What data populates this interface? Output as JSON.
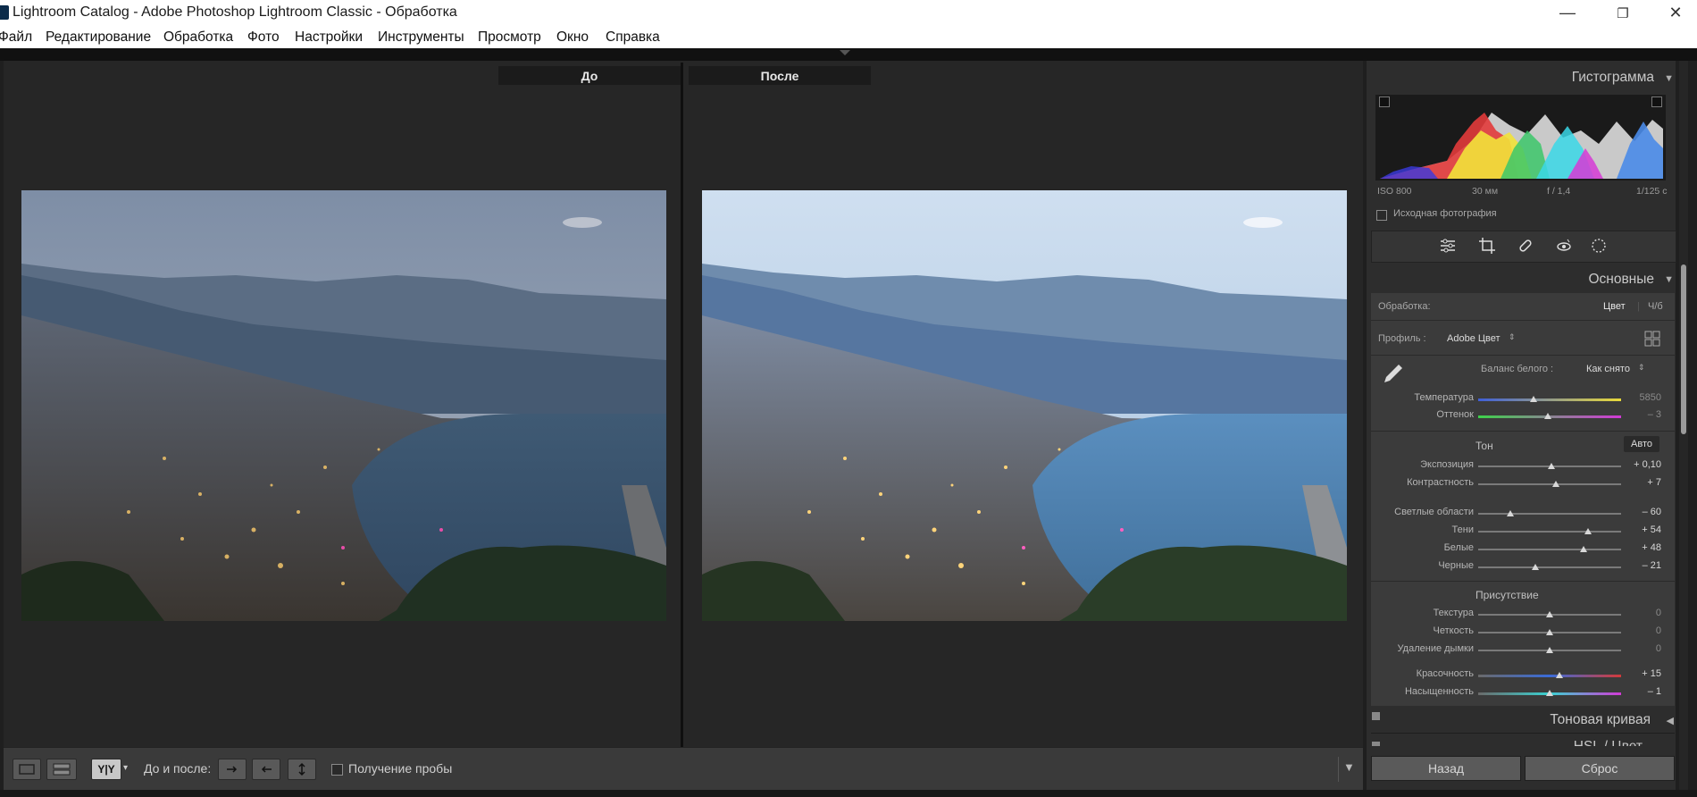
{
  "window": {
    "title": "Lightroom Catalog - Adobe Photoshop Lightroom Classic - Обработка",
    "minimize_icon": "—",
    "maximize_icon": "❐",
    "close_icon": "✕"
  },
  "menu": [
    "Файл",
    "Редактирование",
    "Обработка",
    "Фото",
    "Настройки",
    "Инструменты",
    "Просмотр",
    "Окно",
    "Справка"
  ],
  "view": {
    "before_label": "До",
    "after_label": "После"
  },
  "toolbar": {
    "view_mode_label": "Y|Y",
    "before_after_label": "До и после:",
    "sample_label": "Получение пробы"
  },
  "panel": {
    "histogram": {
      "title": "Гистограмма",
      "iso": "ISO 800",
      "focal": "30 мм",
      "aperture": "f / 1,4",
      "shutter": "1/125 с",
      "original_photo_label": "Исходная фотография"
    },
    "basic": {
      "title": "Основные",
      "treatment_label": "Обработка:",
      "treatment_color": "Цвет",
      "treatment_bw": "Ч/б",
      "profile_label": "Профиль :",
      "profile_value": "Adobe Цвет",
      "wb_label": "Баланс белого :",
      "wb_value": "Как снято",
      "temperature_label": "Температура",
      "temperature_value": "5850",
      "temperature_pos": 0.4,
      "tint_label": "Оттенок",
      "tint_value": "– 3",
      "tint_pos": 0.49,
      "tone_title": "Тон",
      "auto_label": "Авто",
      "tone_sliders": [
        {
          "label": "Экспозиция",
          "value": "+ 0,10",
          "pos": 0.51
        },
        {
          "label": "Контрастность",
          "value": "+ 7",
          "pos": 0.54
        }
      ],
      "tone_sliders2": [
        {
          "label": "Светлые области",
          "value": "– 60",
          "pos": 0.22
        },
        {
          "label": "Тени",
          "value": "+ 54",
          "pos": 0.77
        },
        {
          "label": "Белые",
          "value": "+ 48",
          "pos": 0.74
        },
        {
          "label": "Черные",
          "value": "– 21",
          "pos": 0.4
        }
      ],
      "presence_title": "Присутствие",
      "presence_sliders": [
        {
          "label": "Текстура",
          "value": "0",
          "pos": 0.5
        },
        {
          "label": "Четкость",
          "value": "0",
          "pos": 0.5
        },
        {
          "label": "Удаление дымки",
          "value": "0",
          "pos": 0.5
        }
      ],
      "color_sliders": [
        {
          "label": "Красочность",
          "value": "+ 15",
          "pos": 0.57
        },
        {
          "label": "Насыщенность",
          "value": "– 1",
          "pos": 0.5
        }
      ]
    },
    "tone_curve_title": "Тоновая кривая",
    "hsl_title": "HSL / Цвет",
    "back_button": "Назад",
    "reset_button": "Сброс"
  }
}
